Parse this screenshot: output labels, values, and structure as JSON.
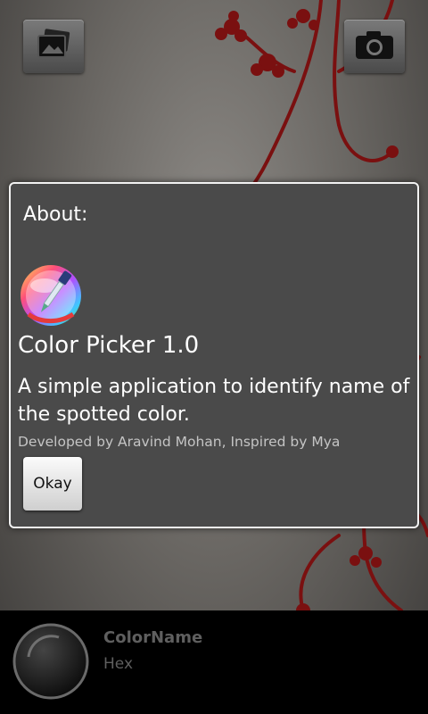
{
  "toolbar": {
    "gallery_icon": "gallery-icon",
    "camera_icon": "camera-icon"
  },
  "dialog": {
    "title": "About:",
    "app_icon": "color-picker-app-icon",
    "app_name": "Color Picker 1.0",
    "description": "A simple application to identify name of the spotted color.",
    "credits": "Developed by Aravind Mohan, Inspired by Mya",
    "okay_label": "Okay"
  },
  "bottom_bar": {
    "color_name": "ColorName",
    "hex": "Hex"
  },
  "colors": {
    "dialog_bg": "#4a4a4a",
    "dialog_border": "#f2f2f2",
    "bottom_bar_bg": "#000000",
    "floral_accent": "#7a1010"
  }
}
